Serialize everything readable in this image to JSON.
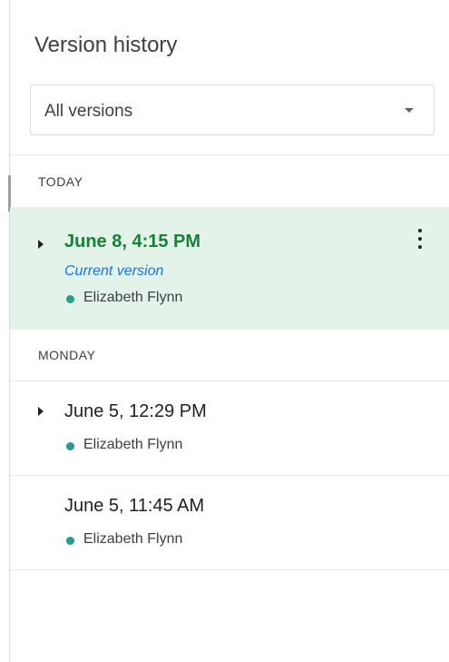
{
  "panel": {
    "title": "Version history",
    "filter": {
      "selected": "All versions"
    }
  },
  "groups": [
    {
      "label": "TODAY",
      "versions": [
        {
          "date": "June 8, 4:15 PM",
          "subtitle": "Current version",
          "author": "Elizabeth Flynn",
          "selected": true
        }
      ]
    },
    {
      "label": "MONDAY",
      "versions": [
        {
          "date": "June 5, 12:29 PM",
          "author": "Elizabeth Flynn"
        },
        {
          "date": "June 5, 11:45 AM",
          "author": "Elizabeth Flynn"
        }
      ]
    }
  ],
  "colors": {
    "selected_bg": "#e3f3e9",
    "selected_text": "#188038",
    "current_version_text": "#1a73e8",
    "author_dot": "#1ea08b"
  }
}
